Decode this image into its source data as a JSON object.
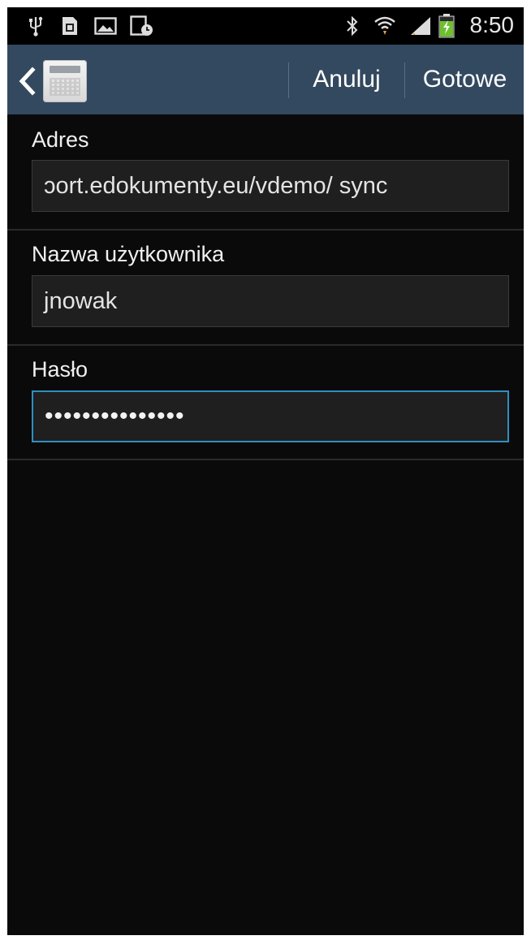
{
  "status_bar": {
    "icons": [
      "usb-icon",
      "sim-card-icon",
      "gallery-icon",
      "storage-icon",
      "bluetooth-icon",
      "wifi-icon",
      "signal-icon",
      "battery-charging-icon"
    ],
    "time": "8:50"
  },
  "action_bar": {
    "app_icon": "calculator-icon",
    "cancel_label": "Anuluj",
    "done_label": "Gotowe"
  },
  "form": {
    "address": {
      "label": "Adres",
      "value": "ɔort.edokumenty.eu/vdemo/ sync"
    },
    "username": {
      "label": "Nazwa użytkownika",
      "value": "jnowak"
    },
    "password": {
      "label": "Hasło",
      "value": "•••••••••••••••"
    }
  },
  "colors": {
    "action_bar_bg": "#33495f",
    "background": "#0a0a0a",
    "focus_border": "#2e8fc0",
    "battery_green": "#6fbf2f"
  }
}
